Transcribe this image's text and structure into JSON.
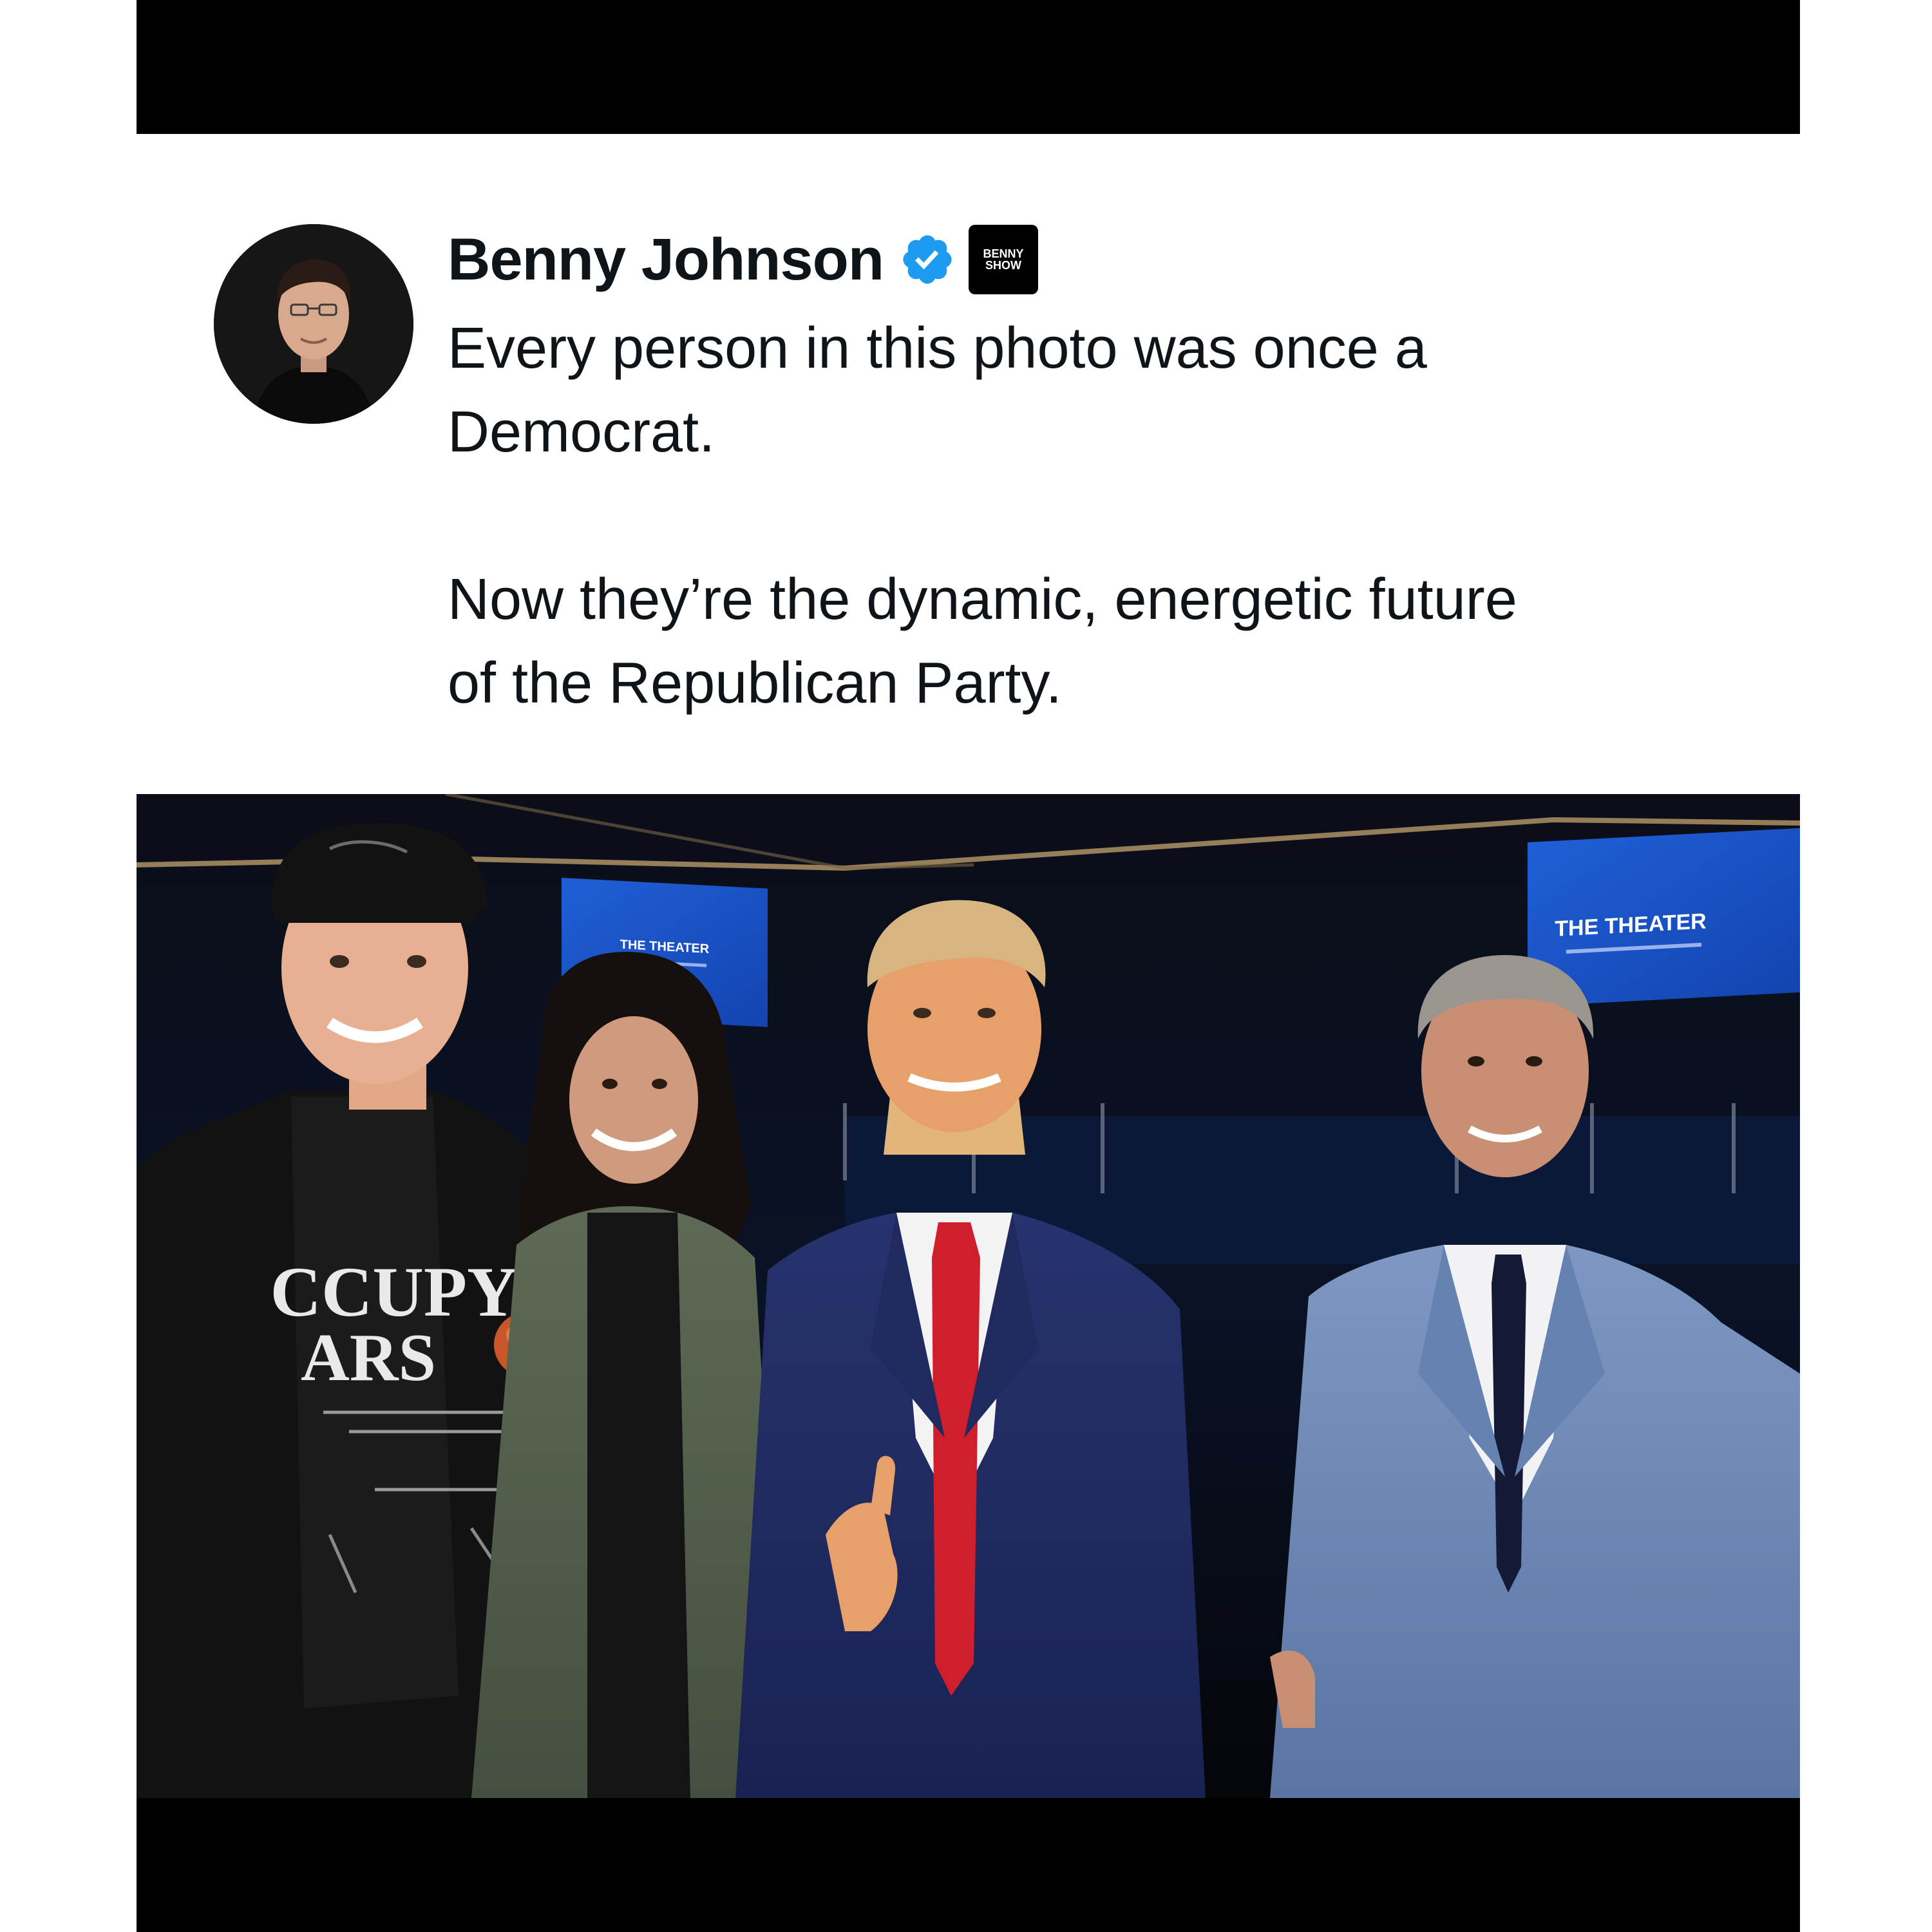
{
  "post": {
    "author_name": "Benny Johnson",
    "verified": true,
    "affiliation_badge_text": "BENNY SHOW",
    "text": "Every person in this photo was once a\nDemocrat.\n\nNow they’re the dynamic, energetic future\nof the Republican Party."
  },
  "photo": {
    "screen_left_label": "THE THEATER",
    "screen_right_label": "THE THEATER",
    "shirt_text_line1": "CCUPY",
    "shirt_text_line2": "ARS"
  },
  "colors": {
    "verified_blue": "#1d9bf0",
    "text_primary": "#0f1419",
    "letterbox": "#000000"
  }
}
